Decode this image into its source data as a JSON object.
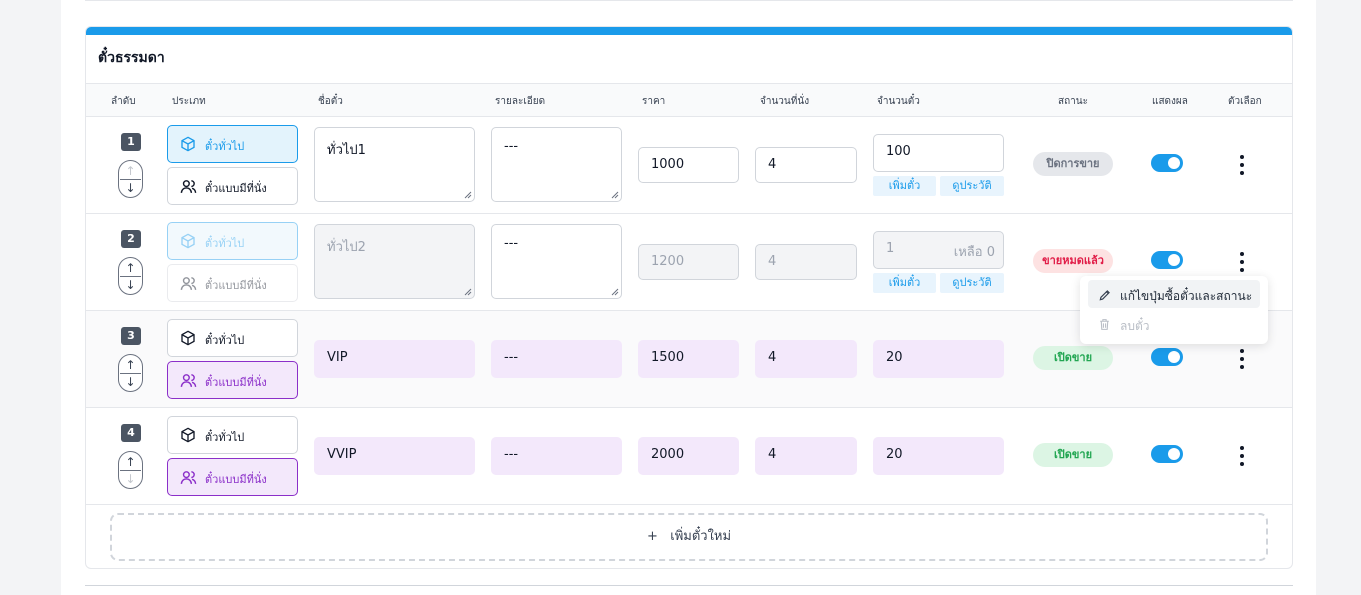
{
  "section": {
    "title": "ตั๋วธรรมดา",
    "columns": [
      "ลำดับ",
      "ประเภท",
      "ชื่อตั๋ว",
      "รายละเอียด",
      "ราคา",
      "จำนวนที่นั่ง",
      "จำนวนตั๋ว",
      "สถานะ",
      "แสดงผล",
      "ตัวเลือก"
    ],
    "type_options": {
      "general": "ตั๋วทั่วไป",
      "seated": "ตั๋วแบบมีที่นั่ง"
    },
    "add_stock_label": "เพิ่มตั๋ว",
    "history_label": "ดูประวัติ",
    "add_ticket_label": "เพิ่มตั๋วใหม่",
    "add_ticket_icon": "+"
  },
  "rows": [
    {
      "order": "1",
      "type": "general",
      "name": "ทั่วไป1",
      "detail": "---",
      "price": "1000",
      "seats": "4",
      "quantity": "100",
      "remaining": "",
      "status": "ปิดการขาย",
      "status_color": "#e5e7eb",
      "visible": true
    },
    {
      "order": "2",
      "type": "general",
      "name": "ทั่วไป2",
      "detail": "---",
      "price": "1200",
      "seats": "4",
      "quantity": "1",
      "remaining": "เหลือ 0",
      "status": "ขายหมดแล้ว",
      "status_color": "#fde2e2",
      "visible": true
    },
    {
      "order": "3",
      "type": "seated",
      "name": "VIP",
      "detail": "---",
      "price": "1500",
      "seats": "4",
      "quantity": "20",
      "remaining": "",
      "status": "เปิดขาย",
      "status_color": "#dcf5e4",
      "visible": true
    },
    {
      "order": "4",
      "type": "seated",
      "name": "VVIP",
      "detail": "---",
      "price": "2000",
      "seats": "4",
      "quantity": "20",
      "remaining": "",
      "status": "เปิดขาย",
      "status_color": "#dcf5e4",
      "visible": true
    }
  ],
  "context_menu": {
    "edit_label": "แก้ไขปุ่มซื้อตั๋วและสถานะ",
    "edit_icon": "pencil-icon",
    "delete_label": "ลบตั๋ว",
    "delete_icon": "trash-icon"
  },
  "colors": {
    "accent": "#1a9bea",
    "purple": "#8b2fc9",
    "purple_bg": "#f3e8fb"
  }
}
